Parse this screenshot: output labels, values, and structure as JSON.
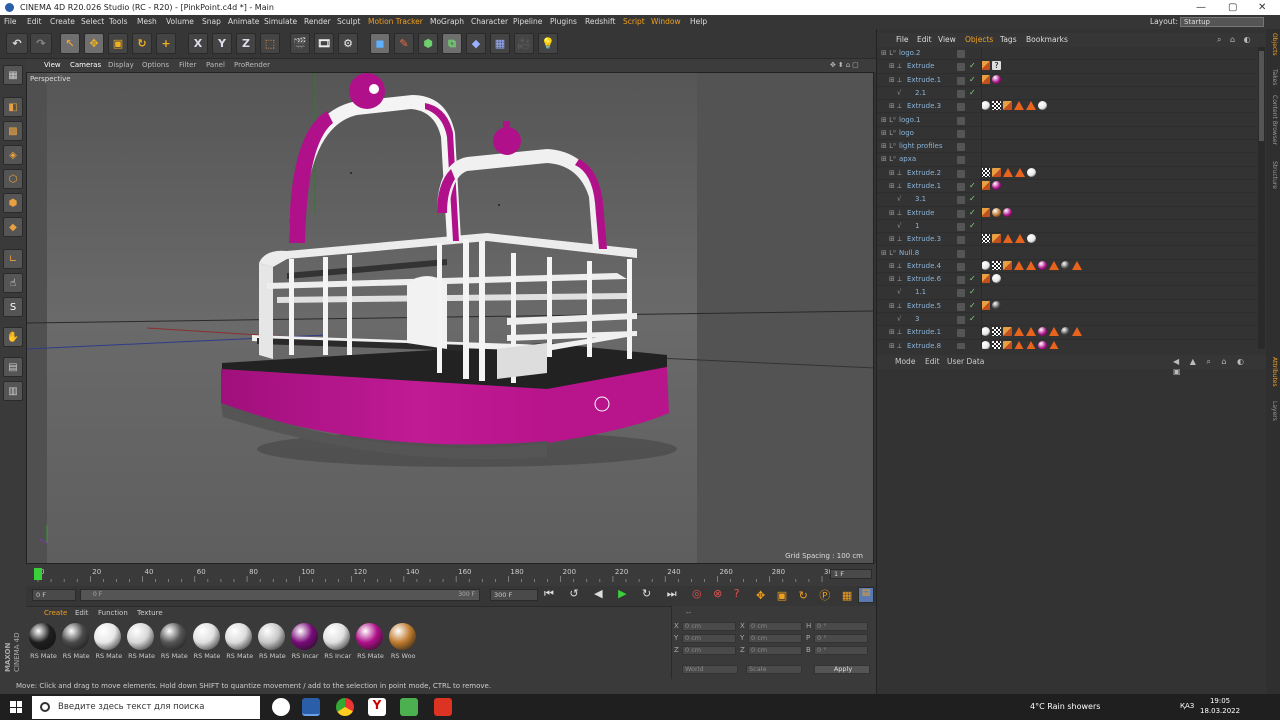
{
  "window": {
    "title": "CINEMA 4D R20.026 Studio (RC - R20) - [PinkPoint.c4d *] - Main",
    "controls": [
      "—",
      "▢",
      "✕"
    ]
  },
  "menubar": {
    "items": [
      "File",
      "Edit",
      "Create",
      "Select",
      "Tools",
      "Mesh",
      "Volume",
      "Snap",
      "Animate",
      "Simulate",
      "Render",
      "Sculpt",
      "Motion Tracker",
      "MoGraph",
      "Character",
      "Pipeline",
      "Plugins",
      "Redshift",
      "Script",
      "Window",
      "Help"
    ],
    "highlight": [
      "Motion Tracker",
      "Script",
      "Window"
    ],
    "layout_label": "Layout:",
    "layout_value": "Startup"
  },
  "viewport": {
    "menu": [
      "View",
      "Cameras",
      "Display",
      "Options",
      "Filter",
      "Panel",
      "ProRender"
    ],
    "label": "Perspective",
    "grid_spacing": "Grid Spacing : 100 cm",
    "axes": {
      "y_label": "y",
      "z_label": "z"
    }
  },
  "toolbar": {
    "axis_buttons": [
      "X",
      "Y",
      "Z"
    ]
  },
  "timeline": {
    "ticks": [
      "0",
      "20",
      "40",
      "60",
      "80",
      "100",
      "120",
      "140",
      "160",
      "180",
      "200",
      "220",
      "240",
      "260",
      "280",
      "300"
    ],
    "current_frame": "1 F",
    "start": "0 F",
    "range_start": "0 F",
    "range_end": "300 F",
    "end": "300 F"
  },
  "materials": {
    "menu": [
      "Create",
      "Edit",
      "Function",
      "Texture"
    ],
    "items": [
      {
        "label": "RS Mate",
        "color": "#1e1e1e"
      },
      {
        "label": "RS Mate",
        "color": "#4a4a4a"
      },
      {
        "label": "RS Mate",
        "color": "#e8e8e8"
      },
      {
        "label": "RS Mate",
        "color": "#d8d8d8"
      },
      {
        "label": "RS Mate",
        "color": "#555555"
      },
      {
        "label": "RS Mate",
        "color": "#e0e0e0"
      },
      {
        "label": "RS Mate",
        "color": "#dddddd"
      },
      {
        "label": "RS Mate",
        "color": "#c8c8c8"
      },
      {
        "label": "RS Incar",
        "color": "#7a0a7a"
      },
      {
        "label": "RS Incar",
        "color": "#e0e0e0"
      },
      {
        "label": "RS Mate",
        "color": "#b0108a"
      },
      {
        "label": "RS Woo",
        "color": "#c07c30"
      }
    ],
    "brand": [
      "MAXON",
      "CINEMA 4D"
    ]
  },
  "coordinates": {
    "header": "--",
    "rows": [
      {
        "a": "X",
        "av": "0 cm",
        "b": "X",
        "bv": "0 cm",
        "c": "H",
        "cv": "0 °"
      },
      {
        "a": "Y",
        "av": "0 cm",
        "b": "Y",
        "bv": "0 cm",
        "c": "P",
        "cv": "0 °"
      },
      {
        "a": "Z",
        "av": "0 cm",
        "b": "Z",
        "bv": "0 cm",
        "c": "B",
        "cv": "0 °"
      }
    ],
    "mode1": "World",
    "mode2": "Scale",
    "apply": "Apply"
  },
  "status": "Move: Click and drag to move elements. Hold down SHIFT to quantize movement / add to the selection in point mode, CTRL to remove.",
  "objects": {
    "menu": [
      "File",
      "Edit",
      "View",
      "Objects",
      "Tags",
      "Bookmarks"
    ],
    "highlight": [
      "Objects"
    ],
    "rows": [
      {
        "name": "logo.2",
        "indent": 0,
        "check": false,
        "tags": []
      },
      {
        "name": "Extrude",
        "indent": 1,
        "check": true,
        "tags": [
          "orange",
          "qmark"
        ]
      },
      {
        "name": "Extrude.1",
        "indent": 1,
        "check": true,
        "tags": [
          "orange",
          "pink"
        ]
      },
      {
        "name": "2.1",
        "indent": 2,
        "check": true,
        "tags": []
      },
      {
        "name": "Extrude.3",
        "indent": 1,
        "check": false,
        "tags": [
          "white",
          "checker",
          "orange",
          "tri",
          "tri",
          "white"
        ]
      },
      {
        "name": "logo.1",
        "indent": 0,
        "check": false,
        "tags": []
      },
      {
        "name": "logo",
        "indent": 0,
        "check": false,
        "tags": []
      },
      {
        "name": "light profiles",
        "indent": 0,
        "check": false,
        "tags": []
      },
      {
        "name": "apxa",
        "indent": 0,
        "check": false,
        "tags": []
      },
      {
        "name": "Extrude.2",
        "indent": 1,
        "check": false,
        "tags": [
          "checker",
          "orange",
          "tri",
          "tri",
          "white"
        ]
      },
      {
        "name": "Extrude.1",
        "indent": 1,
        "check": true,
        "tags": [
          "orange",
          "pink"
        ]
      },
      {
        "name": "3.1",
        "indent": 2,
        "check": true,
        "tags": []
      },
      {
        "name": "Extrude",
        "indent": 1,
        "check": true,
        "tags": [
          "orange",
          "wood",
          "pink"
        ]
      },
      {
        "name": "1",
        "indent": 2,
        "check": true,
        "tags": []
      },
      {
        "name": "Extrude.3",
        "indent": 1,
        "check": false,
        "tags": [
          "checker",
          "orange",
          "tri",
          "tri",
          "white"
        ]
      },
      {
        "name": "Null.8",
        "indent": 0,
        "check": false,
        "tags": []
      },
      {
        "name": "Extrude.4",
        "indent": 1,
        "check": false,
        "tags": [
          "white",
          "checker",
          "orange",
          "tri",
          "tri",
          "pink",
          "tri",
          "dark",
          "tri"
        ]
      },
      {
        "name": "Extrude.6",
        "indent": 1,
        "check": true,
        "tags": [
          "orange",
          "white"
        ]
      },
      {
        "name": "1.1",
        "indent": 2,
        "check": true,
        "tags": []
      },
      {
        "name": "Extrude.5",
        "indent": 1,
        "check": true,
        "tags": [
          "orange",
          "dark"
        ]
      },
      {
        "name": "3",
        "indent": 2,
        "check": true,
        "tags": []
      },
      {
        "name": "Extrude.1",
        "indent": 1,
        "check": false,
        "tags": [
          "white",
          "checker",
          "orange",
          "tri",
          "tri",
          "pink",
          "tri",
          "dark",
          "tri"
        ]
      },
      {
        "name": "Extrude.8",
        "indent": 1,
        "check": false,
        "tags": [
          "white",
          "checker",
          "orange",
          "tri",
          "tri",
          "pink",
          "tri"
        ]
      }
    ]
  },
  "attributes": {
    "menu": [
      "Mode",
      "Edit",
      "User Data"
    ]
  },
  "right_tabs": [
    "Objects",
    "Takes",
    "Content Browser",
    "Structure",
    "Attributes",
    "Layers"
  ],
  "taskbar": {
    "search_placeholder": "Введите здесь текст для поиска",
    "weather": "4°C  Rain showers",
    "lang": "ҚАЗ",
    "time": "19:05",
    "date": "18.03.2022"
  },
  "colors": {
    "magenta": "#b0108a",
    "accent": "#f0a020",
    "bg": "#333333"
  }
}
